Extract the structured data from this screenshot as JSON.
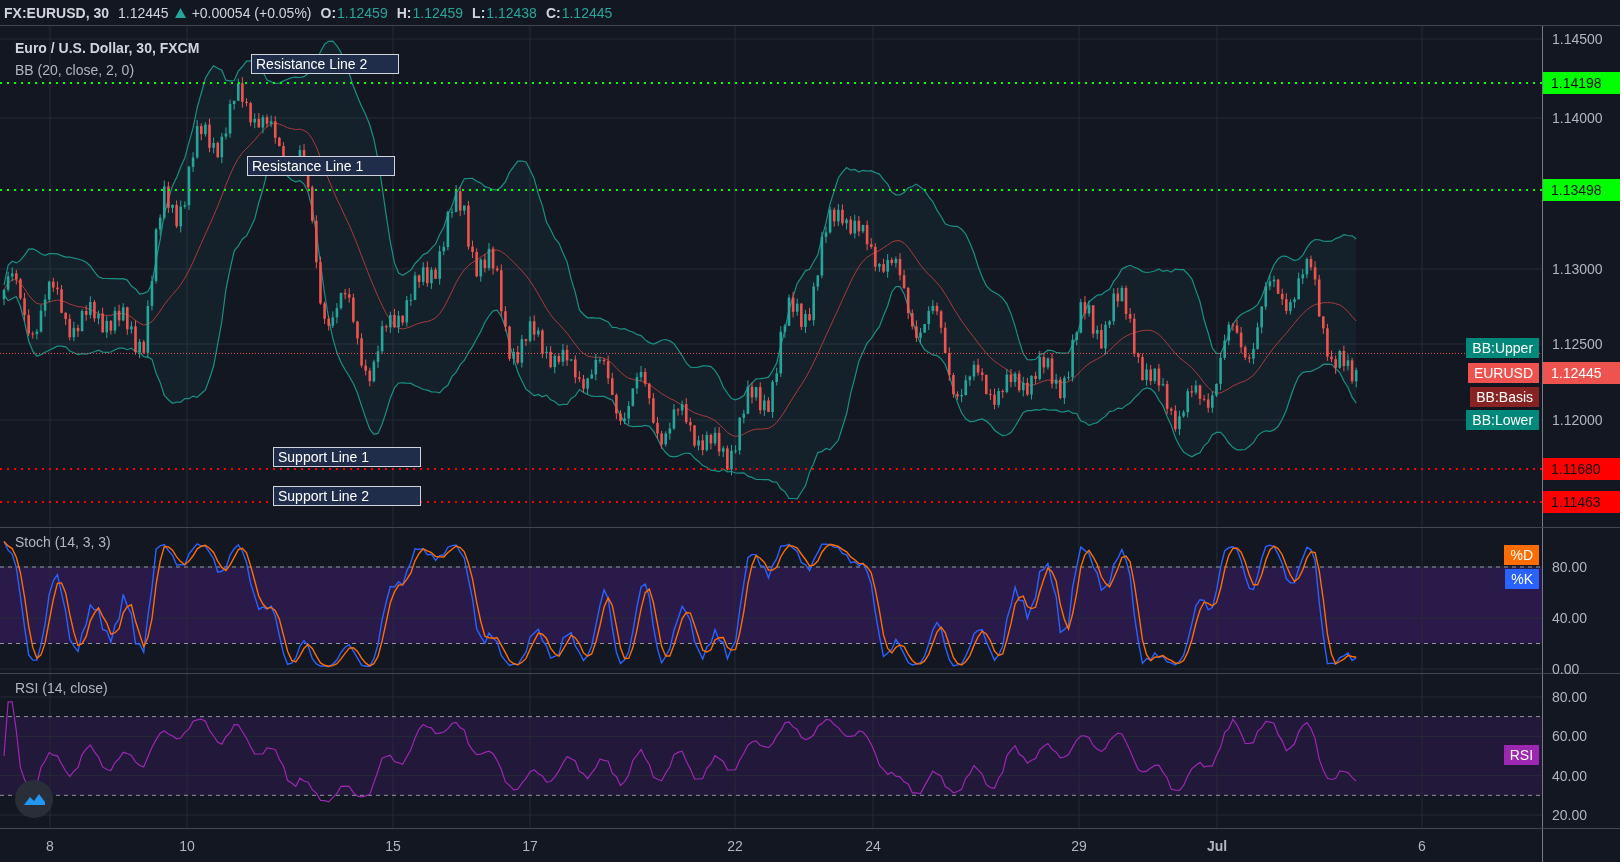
{
  "header": {
    "symbol": "FX:EURUSD, 30",
    "price": "1.12445",
    "change": "+0.00054 (+0.05%)",
    "ohlc": [
      {
        "label": "O:",
        "value": "1.12459"
      },
      {
        "label": "H:",
        "value": "1.12459"
      },
      {
        "label": "L:",
        "value": "1.12438"
      },
      {
        "label": "C:",
        "value": "1.12445"
      }
    ]
  },
  "price_pane": {
    "title": "Euro / U.S. Dollar, 30, FXCM",
    "indicator": "BB (20, close, 2, 0)",
    "axis_ticks": [
      "1.14500",
      "1.14000",
      "1.13000",
      "1.12500",
      "1.12000"
    ],
    "levels": [
      {
        "name": "Resistance Line 2",
        "value": "1.14198",
        "color": "#00ff00"
      },
      {
        "name": "Resistance Line 1",
        "value": "1.13498",
        "color": "#00ff00"
      },
      {
        "name": "Support Line 1",
        "value": "1.11680",
        "color": "#ff0000"
      },
      {
        "name": "Support Line 2",
        "value": "1.11463",
        "color": "#ff0000"
      }
    ],
    "series_tags": [
      {
        "label": "BB:Upper",
        "color": "#00897b"
      },
      {
        "label": "EURUSD",
        "color": "#ef5350"
      },
      {
        "label": "BB:Basis",
        "color": "#872323"
      },
      {
        "label": "BB:Lower",
        "color": "#00897b"
      }
    ],
    "last_price": "1.12445"
  },
  "stoch_pane": {
    "title": "Stoch (14, 3, 3)",
    "axis_ticks": [
      "80.00",
      "40.00",
      "0.00"
    ],
    "series_tags": [
      {
        "label": "%D",
        "color": "#ff6d00"
      },
      {
        "label": "%K",
        "color": "#2962ff"
      }
    ]
  },
  "rsi_pane": {
    "title": "RSI (14, close)",
    "axis_ticks": [
      "80.00",
      "60.00",
      "40.00",
      "20.00"
    ],
    "series_tags": [
      {
        "label": "RSI",
        "color": "#9c27b0"
      }
    ]
  },
  "time_axis": [
    {
      "label": "8",
      "kind": "day"
    },
    {
      "label": "10",
      "kind": "day"
    },
    {
      "label": "15",
      "kind": "day"
    },
    {
      "label": "17",
      "kind": "day"
    },
    {
      "label": "22",
      "kind": "day"
    },
    {
      "label": "24",
      "kind": "day"
    },
    {
      "label": "29",
      "kind": "day"
    },
    {
      "label": "Jul",
      "kind": "month"
    },
    {
      "label": "6",
      "kind": "day"
    }
  ]
}
